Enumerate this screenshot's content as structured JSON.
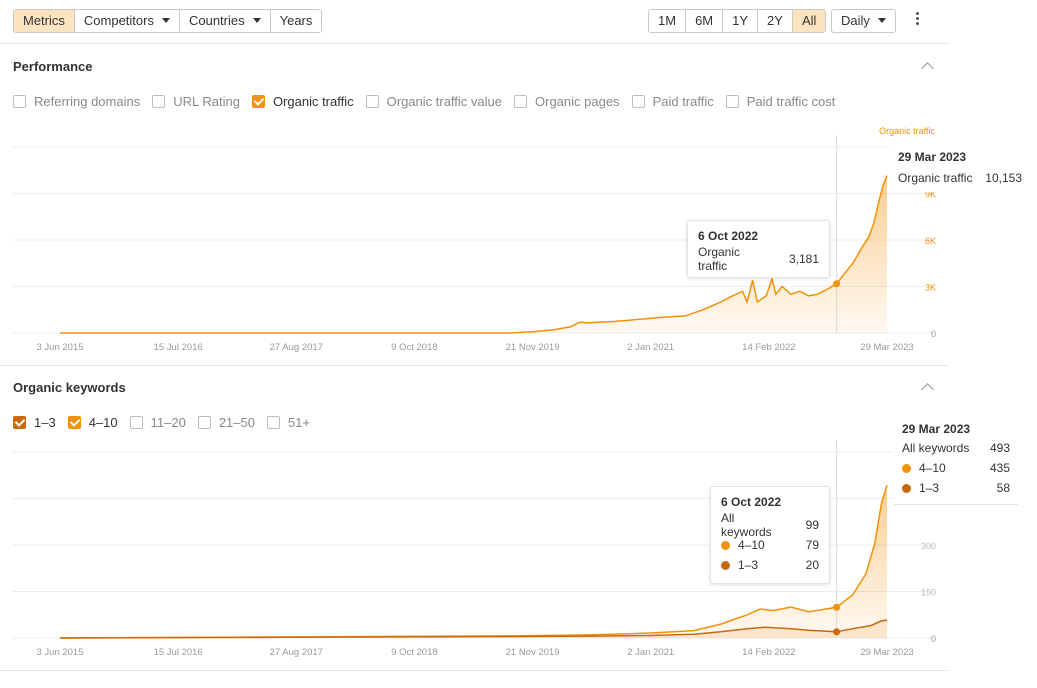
{
  "toolbar": {
    "tabs": [
      {
        "label": "Metrics",
        "active": true
      },
      {
        "label": "Competitors",
        "dropdown": true
      },
      {
        "label": "Countries",
        "dropdown": true
      },
      {
        "label": "Years"
      }
    ],
    "ranges": [
      {
        "label": "1M"
      },
      {
        "label": "6M"
      },
      {
        "label": "1Y"
      },
      {
        "label": "2Y"
      },
      {
        "label": "All",
        "active": true
      }
    ],
    "granularity": "Daily",
    "more_icon": "kebab-menu-icon"
  },
  "colors": {
    "accent": "#f2910a",
    "accent_light": "#fde4c0",
    "dark_series": "#c8690c"
  },
  "performance": {
    "title": "Performance",
    "checkboxes": [
      {
        "label": "Referring domains",
        "checked": false
      },
      {
        "label": "URL Rating",
        "checked": false
      },
      {
        "label": "Organic traffic",
        "checked": true
      },
      {
        "label": "Organic traffic value",
        "checked": false
      },
      {
        "label": "Organic pages",
        "checked": false
      },
      {
        "label": "Paid traffic",
        "checked": false
      },
      {
        "label": "Paid traffic cost",
        "checked": false
      }
    ],
    "tooltip": {
      "date": "6 Oct 2022",
      "label": "Organic traffic",
      "value": "3,181"
    },
    "side": {
      "date": "29 Mar 2023",
      "label": "Organic traffic",
      "value": "10,153"
    }
  },
  "keywords": {
    "title": "Organic keywords",
    "checkboxes": [
      {
        "label": "1–3",
        "checked": true,
        "color": "#c8690c"
      },
      {
        "label": "4–10",
        "checked": true,
        "color": "#f2910a"
      },
      {
        "label": "11–20",
        "checked": false
      },
      {
        "label": "21–50",
        "checked": false
      },
      {
        "label": "51+",
        "checked": false
      }
    ],
    "tooltip": {
      "date": "6 Oct 2022",
      "rows": [
        {
          "label": "All keywords",
          "value": "99"
        },
        {
          "label": "4–10",
          "value": "79",
          "color": "#f2910a"
        },
        {
          "label": "1–3",
          "value": "20",
          "color": "#c8690c"
        }
      ]
    },
    "side": {
      "date": "29 Mar 2023",
      "rows": [
        {
          "label": "All keywords",
          "value": "493"
        },
        {
          "label": "4–10",
          "value": "435",
          "color": "#f2910a"
        },
        {
          "label": "1–3",
          "value": "58",
          "color": "#c8690c"
        }
      ]
    }
  },
  "chart_data": [
    {
      "type": "area",
      "title": "",
      "series": [
        {
          "name": "Organic traffic"
        }
      ],
      "x_labels": [
        "3 Jun 2015",
        "15 Jul 2016",
        "27 Aug 2017",
        "9 Oct 2018",
        "21 Nov 2019",
        "2 Jan 2021",
        "14 Feb 2022",
        "29 Mar 2023"
      ],
      "y_ticks": [
        "0",
        "3K",
        "6K",
        "9K"
      ],
      "y_tick_values": [
        0,
        3000,
        6000,
        9000
      ],
      "ylim": [
        0,
        12000
      ],
      "xlim": [
        "2015-06-03",
        "2023-03-29"
      ],
      "grid": true,
      "points": [
        [
          "2015-06-03",
          0
        ],
        [
          "2019-09-01",
          0
        ],
        [
          "2019-11-21",
          80
        ],
        [
          "2020-02-01",
          200
        ],
        [
          "2020-04-01",
          400
        ],
        [
          "2020-05-01",
          700
        ],
        [
          "2020-06-01",
          650
        ],
        [
          "2020-09-01",
          750
        ],
        [
          "2020-12-01",
          900
        ],
        [
          "2021-02-01",
          1000
        ],
        [
          "2021-05-01",
          1100
        ],
        [
          "2021-07-01",
          1500
        ],
        [
          "2021-09-01",
          2000
        ],
        [
          "2021-10-01",
          2300
        ],
        [
          "2021-11-15",
          2700
        ],
        [
          "2021-12-01",
          2000
        ],
        [
          "2021-12-20",
          3400
        ],
        [
          "2022-01-05",
          2000
        ],
        [
          "2022-02-05",
          2400
        ],
        [
          "2022-02-25",
          3500
        ],
        [
          "2022-03-10",
          2500
        ],
        [
          "2022-04-01",
          3000
        ],
        [
          "2022-05-01",
          2500
        ],
        [
          "2022-06-01",
          2700
        ],
        [
          "2022-07-01",
          2400
        ],
        [
          "2022-08-01",
          2500
        ],
        [
          "2022-09-01",
          2800
        ],
        [
          "2022-10-06",
          3181
        ],
        [
          "2022-11-01",
          3800
        ],
        [
          "2022-12-01",
          4500
        ],
        [
          "2023-01-01",
          5500
        ],
        [
          "2023-01-25",
          6200
        ],
        [
          "2023-02-10",
          7000
        ],
        [
          "2023-03-01",
          8500
        ],
        [
          "2023-03-15",
          9500
        ],
        [
          "2023-03-29",
          10153
        ]
      ],
      "highlight": [
        {
          "date": "2022-10-06",
          "value": 3181
        }
      ]
    },
    {
      "type": "area",
      "title": "",
      "series": [
        {
          "name": "4–10"
        },
        {
          "name": "1–3"
        }
      ],
      "x_labels": [
        "3 Jun 2015",
        "15 Jul 2016",
        "27 Aug 2017",
        "9 Oct 2018",
        "21 Nov 2019",
        "2 Jan 2021",
        "14 Feb 2022",
        "29 Mar 2023"
      ],
      "y_ticks": [
        "0",
        "150",
        "300",
        "450"
      ],
      "y_tick_values": [
        0,
        150,
        300,
        450
      ],
      "ylim": [
        0,
        600
      ],
      "xlim": [
        "2015-06-03",
        "2023-03-29"
      ],
      "grid": true,
      "stacked": true,
      "series_points": [
        {
          "name": "4–10",
          "points": [
            [
              "2015-06-03",
              0
            ],
            [
              "2019-11-01",
              2
            ],
            [
              "2020-06-01",
              4
            ],
            [
              "2021-01-01",
              8
            ],
            [
              "2021-06-01",
              12
            ],
            [
              "2021-09-01",
              25
            ],
            [
              "2021-12-01",
              45
            ],
            [
              "2022-01-15",
              60
            ],
            [
              "2022-03-01",
              55
            ],
            [
              "2022-05-01",
              70
            ],
            [
              "2022-07-01",
              60
            ],
            [
              "2022-10-06",
              79
            ],
            [
              "2022-12-01",
              110
            ],
            [
              "2023-01-15",
              170
            ],
            [
              "2023-02-15",
              260
            ],
            [
              "2023-03-10",
              380
            ],
            [
              "2023-03-29",
              435
            ]
          ]
        },
        {
          "name": "1–3",
          "points": [
            [
              "2015-06-03",
              0
            ],
            [
              "2019-11-01",
              5
            ],
            [
              "2020-06-01",
              6
            ],
            [
              "2021-01-01",
              8
            ],
            [
              "2021-06-01",
              12
            ],
            [
              "2021-09-01",
              20
            ],
            [
              "2021-12-01",
              30
            ],
            [
              "2022-02-01",
              35
            ],
            [
              "2022-05-01",
              30
            ],
            [
              "2022-07-01",
              25
            ],
            [
              "2022-10-06",
              20
            ],
            [
              "2022-12-01",
              30
            ],
            [
              "2023-02-01",
              40
            ],
            [
              "2023-03-10",
              55
            ],
            [
              "2023-03-29",
              58
            ]
          ]
        }
      ],
      "highlight": [
        {
          "date": "2022-10-06",
          "value": 99
        },
        {
          "date": "2022-10-06",
          "value": 20
        }
      ]
    }
  ]
}
